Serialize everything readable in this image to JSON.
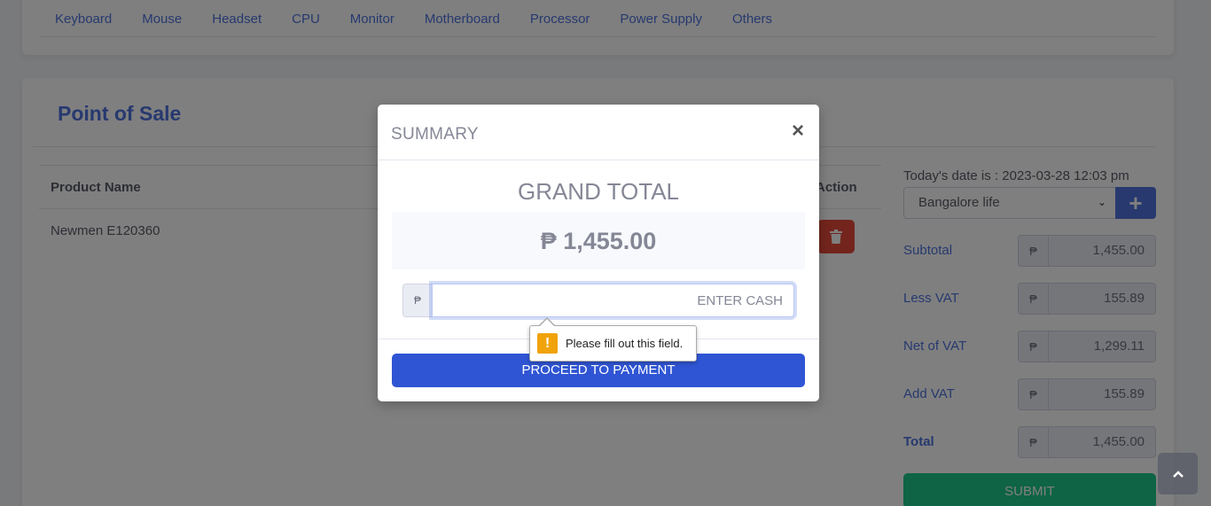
{
  "categories": [
    "Keyboard",
    "Mouse",
    "Headset",
    "CPU",
    "Monitor",
    "Motherboard",
    "Processor",
    "Power Supply",
    "Others"
  ],
  "pos": {
    "title": "Point of Sale",
    "table": {
      "headers": {
        "product_name": "Product Name",
        "action": "Action"
      },
      "rows": [
        {
          "product_name": "Newmen E120360"
        }
      ]
    },
    "date_label": "Today's date is : 2023-03-28 12:03 pm",
    "customer_selected": "Bangalore life",
    "add_button": "+",
    "currency": "₱",
    "summary": [
      {
        "label": "Subtotal",
        "value": "1,455.00"
      },
      {
        "label": "Less VAT",
        "value": "155.89"
      },
      {
        "label": "Net of VAT",
        "value": "1,299.11"
      },
      {
        "label": "Add VAT",
        "value": "155.89"
      },
      {
        "label": "Total",
        "value": "1,455.00"
      }
    ],
    "submit_label": "SUBMIT"
  },
  "modal": {
    "title": "SUMMARY",
    "close": "×",
    "grand_total_label": "GRAND TOTAL",
    "grand_total_value": "₱ 1,455.00",
    "cash_prefix": "₱",
    "cash_placeholder": "ENTER CASH",
    "pay_button": "PROCEED TO PAYMENT"
  },
  "validation": {
    "icon": "!",
    "message": "Please fill out this field."
  },
  "colors": {
    "primary": "#4e73df",
    "pay_button": "#2f55d4",
    "success": "#1cc88a",
    "danger": "#e74a3b",
    "warning": "#f0a30a"
  }
}
